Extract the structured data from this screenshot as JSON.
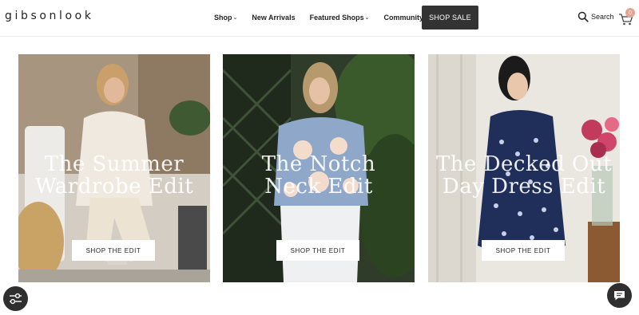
{
  "brand": {
    "logo": "gibsonlook"
  },
  "nav": {
    "items": [
      {
        "label": "Shop",
        "has_dropdown": true
      },
      {
        "label": "New Arrivals",
        "has_dropdown": false
      },
      {
        "label": "Featured Shops",
        "has_dropdown": true
      },
      {
        "label": "Community",
        "has_dropdown": true
      }
    ],
    "chevron": "⌄",
    "shop_sale": "SHOP SALE"
  },
  "header_actions": {
    "search_label": "Search",
    "cart_count": "0"
  },
  "cards": [
    {
      "title_line1": "The Summer",
      "title_line2": "Wardrobe Edit",
      "button": "SHOP THE EDIT"
    },
    {
      "title_line1": "The Notch",
      "title_line2": "Neck Edit",
      "button": "SHOP THE EDIT"
    },
    {
      "title_line1": "The Decked Out",
      "title_line2": "Day Dress Edit",
      "button": "SHOP THE EDIT"
    }
  ],
  "colors": {
    "dark": "#333333",
    "badge": "#e7a393"
  },
  "icons": [
    "search-icon",
    "cart-icon",
    "filter-icon",
    "chat-icon",
    "chevron-down-icon"
  ]
}
